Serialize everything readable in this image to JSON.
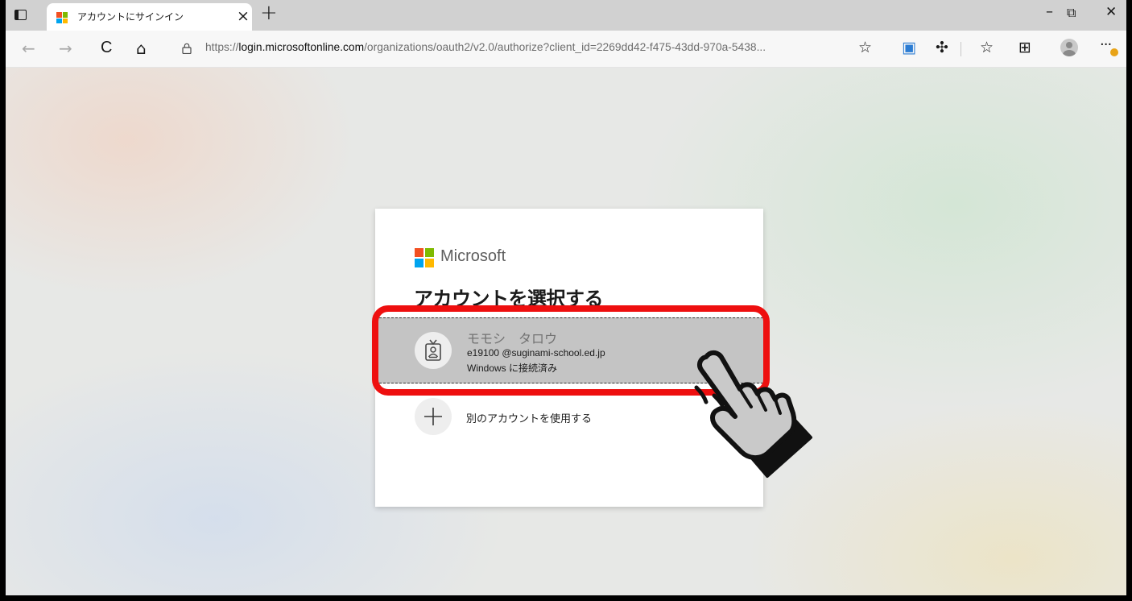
{
  "browser": {
    "tab": {
      "title": "アカウントにサインイン",
      "close_glyph": "×"
    },
    "new_tab_glyph": "+",
    "window_controls": {
      "minimize": "–",
      "restore": "⧉",
      "close": "✕"
    },
    "nav": {
      "back": "←",
      "forward": "→",
      "refresh": "C",
      "home": "⌂"
    },
    "url": {
      "scheme": "https://",
      "host": "login.microsoftonline.com",
      "path": "/organizations/oauth2/v2.0/authorize?client_id=2269dd42-f475-43dd-970a-5438..."
    },
    "toolbar_glyphs": {
      "add_favorite": "☆",
      "screenshot": "▣",
      "extensions": "✣",
      "favorites": "☆",
      "collections": "⊞",
      "more": "···"
    }
  },
  "signin": {
    "brand": "Microsoft",
    "title": "アカウントを選択する",
    "account": {
      "name": "モモシ　タロウ",
      "email": "e19100 @suginami-school.ed.jp",
      "status": "Windows に接続済み"
    },
    "other_account_label": "別のアカウントを使用する"
  },
  "colors": {
    "ms_red": "#f25022",
    "ms_green": "#7fba00",
    "ms_blue": "#00a4ef",
    "ms_yellow": "#ffb900",
    "highlight_red": "#ee0f0f",
    "tile_selected": "#c4c4c4"
  },
  "icons": {
    "tab_actions": "tab-actions-icon",
    "lock": "lock-icon",
    "account_badge": "id-badge-icon",
    "add": "plus-icon",
    "pointer": "pointing-hand-icon"
  }
}
